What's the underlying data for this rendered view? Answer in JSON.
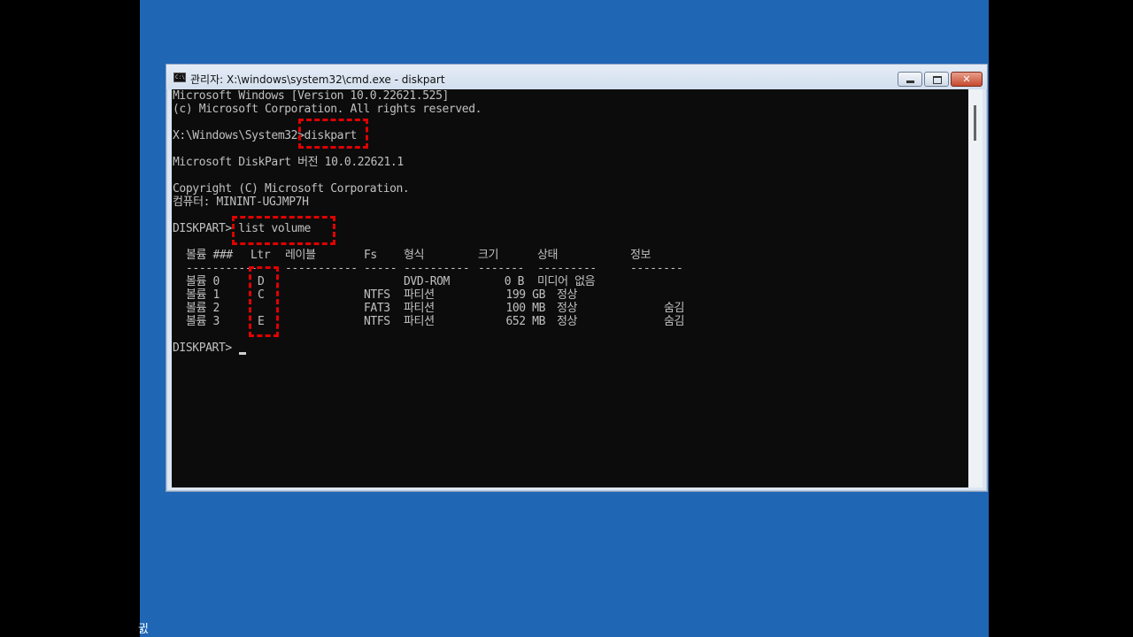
{
  "window": {
    "title": "관리자: X:\\windows\\system32\\cmd.exe - diskpart"
  },
  "console": {
    "lines": [
      "Microsoft Windows [Version 10.0.22621.525]",
      "(c) Microsoft Corporation. All rights reserved.",
      "X:\\Windows\\System32>diskpart",
      "Microsoft DiskPart 버전 10.0.22621.1",
      "Copyright (C) Microsoft Corporation.",
      "컴퓨터: MININT-UGJMP7H",
      "DISKPART> list volume",
      "DISKPART> "
    ],
    "volume_table": {
      "headers": [
        "볼륨 ###",
        "Ltr",
        "레이블",
        "Fs",
        "형식",
        "크기",
        "상태",
        "정보"
      ],
      "separators": [
        "----------",
        "---",
        "-----------",
        "-----",
        "----------",
        "-------",
        "---------",
        "--------"
      ],
      "rows": [
        {
          "vol": "볼륨 0",
          "ltr": "D",
          "label": "",
          "fs": "",
          "type": "DVD-ROM",
          "size": "0 B",
          "status": "미디어 없음",
          "info": ""
        },
        {
          "vol": "볼륨 1",
          "ltr": "C",
          "label": "",
          "fs": "NTFS",
          "type": "파티션",
          "size": "199 GB",
          "status": "정상",
          "info": ""
        },
        {
          "vol": "볼륨 2",
          "ltr": "",
          "label": "",
          "fs": "FAT3",
          "type": "파티션",
          "size": "100 MB",
          "status": "정상",
          "info": "숨김"
        },
        {
          "vol": "볼륨 3",
          "ltr": "E",
          "label": "",
          "fs": "NTFS",
          "type": "파티션",
          "size": "652 MB",
          "status": "정상",
          "info": "숨김"
        }
      ]
    }
  },
  "desktop": {
    "corner_glyph": "귌"
  },
  "colors": {
    "desktop": "#1f66b5",
    "console_bg": "#0c0c0c",
    "console_text": "#c0c0c0",
    "highlight": "#e00000"
  }
}
